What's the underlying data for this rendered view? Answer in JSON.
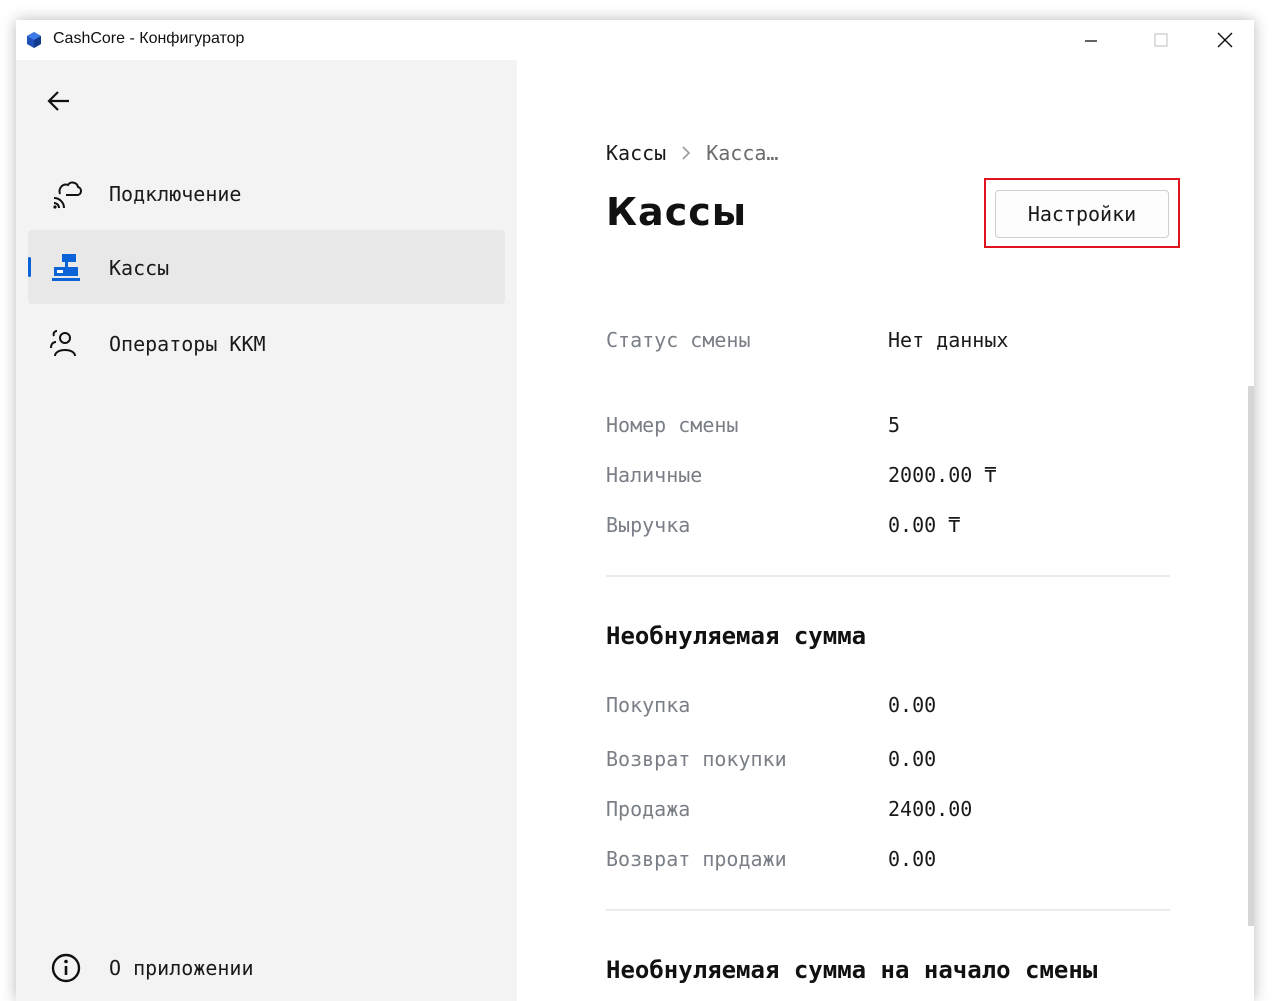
{
  "window": {
    "title": "CashCore - Конфигуратор"
  },
  "sidebar": {
    "items": [
      {
        "label": "Подключение",
        "icon": "cloud-connection-icon"
      },
      {
        "label": "Кассы",
        "icon": "cash-register-icon",
        "active": true
      },
      {
        "label": "Операторы ККМ",
        "icon": "operators-icon"
      }
    ],
    "about": {
      "label": "О приложении",
      "icon": "info-icon"
    }
  },
  "breadcrumb": {
    "root": "Кассы",
    "current": "Касса…"
  },
  "page": {
    "title": "Кассы",
    "settings_button": "Настройки"
  },
  "shift": {
    "status_label": "Статус смены",
    "status_value": "Нет данных",
    "number_label": "Номер смены",
    "number_value": "5",
    "cash_label": "Наличные",
    "cash_value": "2000.00 ₸",
    "revenue_label": "Выручка",
    "revenue_value": "0.00 ₸"
  },
  "non_reset": {
    "title": "Необнуляемая сумма",
    "rows": [
      {
        "label": "Покупка",
        "value": "0.00"
      },
      {
        "label": "Возврат покупки",
        "value": "0.00"
      },
      {
        "label": "Продажа",
        "value": "2400.00"
      },
      {
        "label": "Возврат продажи",
        "value": "0.00"
      }
    ]
  },
  "non_reset_start": {
    "title": "Необнуляемая сумма на начало смены"
  },
  "colors": {
    "accent": "#0a64d8",
    "highlight": "#e0141e",
    "sidebar_bg": "#f3f3f3"
  }
}
